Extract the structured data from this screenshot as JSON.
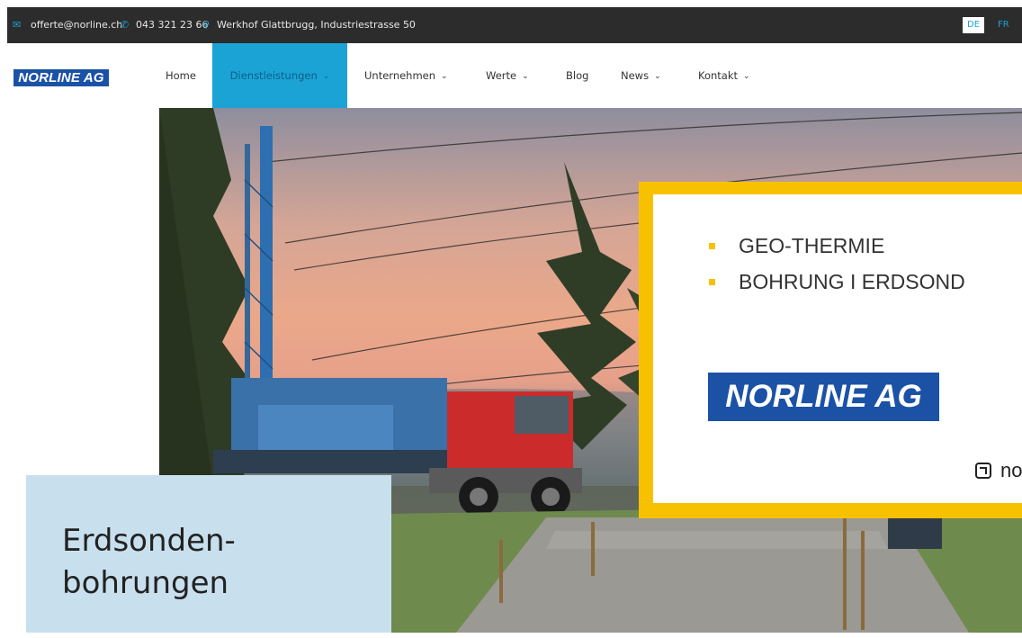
{
  "topbar": {
    "email_icon": "mail-icon",
    "email": "offerte@norline.ch",
    "phone_icon": "phone-icon",
    "phone": "043 321 23 66",
    "location_icon": "map-pin-icon",
    "address": "Werkhof Glattbrugg, Industriestrasse 50",
    "languages": [
      {
        "code": "DE",
        "active": true
      },
      {
        "code": "FR",
        "active": false
      }
    ]
  },
  "nav": {
    "logo_text": "NORLINE AG",
    "items": [
      {
        "label": "Home",
        "has_dropdown": false,
        "active": false
      },
      {
        "label": "Dienstleistungen",
        "has_dropdown": true,
        "active": true
      },
      {
        "label": "Unternehmen",
        "has_dropdown": true,
        "active": false
      },
      {
        "label": "Werte",
        "has_dropdown": true,
        "active": false
      },
      {
        "label": "Blog",
        "has_dropdown": false,
        "active": false
      },
      {
        "label": "News",
        "has_dropdown": true,
        "active": false
      },
      {
        "label": "Kontakt",
        "has_dropdown": true,
        "active": false
      }
    ],
    "caret": "⌄"
  },
  "hero": {
    "card": {
      "bullets": [
        "GEO-THERMIE",
        "BOHRUNG I ERDSOND"
      ],
      "logo_text": "NORLINE AG",
      "link_text": "no"
    },
    "title": "Erdsonden-\nbohrungen"
  },
  "colors": {
    "topbar_bg": "#2c2c2c",
    "accent_blue": "#1ba3d6",
    "brand_blue": "#1b52a6",
    "accent_yellow": "#f8c100",
    "title_box_bg": "#c8e0ee"
  }
}
